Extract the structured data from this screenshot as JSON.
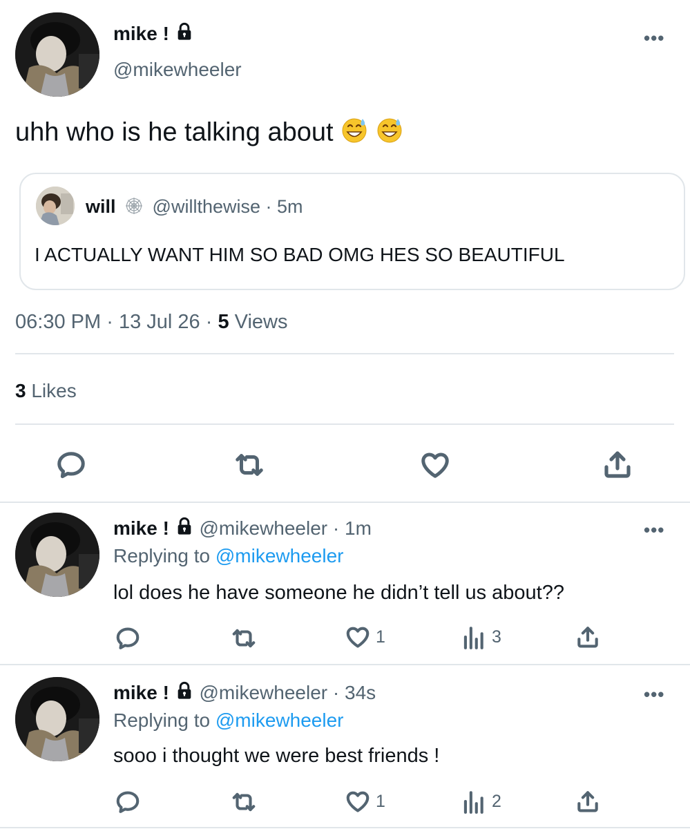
{
  "main_tweet": {
    "author_name": "mike !",
    "handle": "@mikewheeler",
    "text": "uhh who is he talking about",
    "emoji": [
      "grinning-sweat-emoji",
      "grinning-sweat-emoji"
    ],
    "quote": {
      "author_name": "will",
      "handle": "@willthewise",
      "time": "· 5m",
      "text": "I ACTUALLY WANT HIM SO BAD OMG HES SO BEAUTIFUL"
    },
    "meta": {
      "time": "06:30 PM",
      "sep1": "·",
      "date": "13 Jul 26",
      "sep2": "·",
      "views_count": "5",
      "views_label": "Views"
    },
    "likes_count": "3",
    "likes_label": "Likes",
    "actions": [
      "reply-icon",
      "retweet-icon",
      "like-icon",
      "share-icon"
    ]
  },
  "replies": [
    {
      "author_name": "mike !",
      "handle": "@mikewheeler",
      "time": "· 1m",
      "replying_prefix": "Replying to",
      "replying_to": "@mikewheeler",
      "text": "lol does he have someone he didn’t tell us about??",
      "likes": "1",
      "views": "3"
    },
    {
      "author_name": "mike !",
      "handle": "@mikewheeler",
      "time": "· 34s",
      "replying_prefix": "Replying to",
      "replying_to": "@mikewheeler",
      "text": "sooo i thought we were best friends !",
      "likes": "1",
      "views": "2"
    }
  ],
  "colors": {
    "text": "#0f1419",
    "secondary": "#536471",
    "link": "#1d9bf0",
    "divider": "#e1e6ea"
  }
}
